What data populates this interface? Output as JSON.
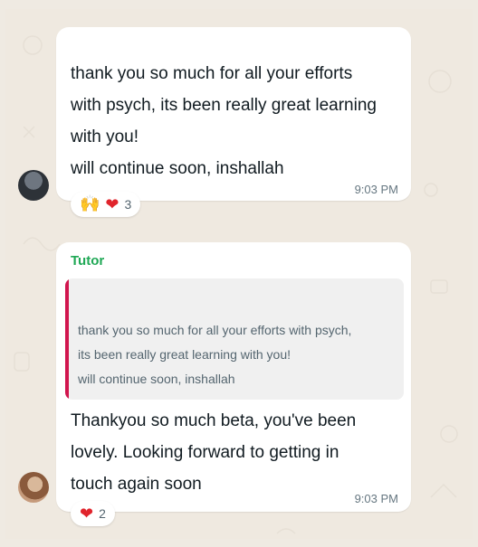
{
  "messages": [
    {
      "lines": [
        "thank you so much for all your efforts",
        "with psych, its been really great learning",
        "with you!",
        "will continue soon, inshallah"
      ],
      "time": "9:03 PM",
      "reactions": {
        "emojis": [
          "raised-hands",
          "heart"
        ],
        "count": "3"
      }
    },
    {
      "sender": "Tutor",
      "quoted_lines": [
        "thank you so much for all your efforts with psych,",
        "its been really great learning with you!",
        "will continue soon, inshallah"
      ],
      "lines": [
        "Thankyou so much beta, you've been",
        "lovely. Looking forward to getting in",
        "touch again soon"
      ],
      "time": "9:03 PM",
      "reactions": {
        "emojis": [
          "heart"
        ],
        "count": "2"
      }
    }
  ],
  "colors": {
    "sender": "#1fa855",
    "quote_bar": "#d1154e",
    "heart": "#e0242c",
    "background": "#efe9e0"
  }
}
